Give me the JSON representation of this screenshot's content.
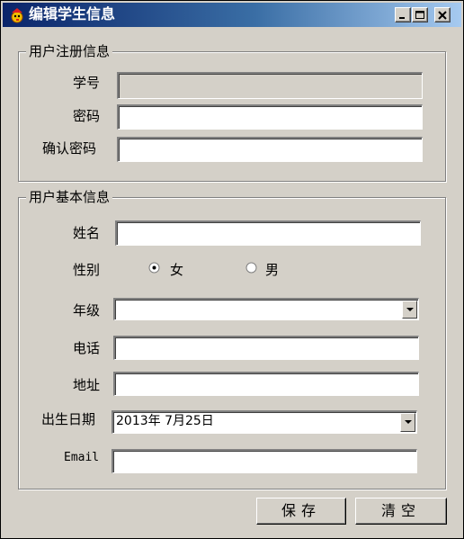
{
  "window": {
    "title": "编辑学生信息",
    "icon": "app-icon",
    "controls": {
      "minimize_icon": "minimize-icon",
      "maximize_icon": "maximize-icon",
      "close_icon": "close-icon"
    }
  },
  "registration": {
    "legend": "用户注册信息",
    "student_id": {
      "label": "学号",
      "value": ""
    },
    "password": {
      "label": "密码",
      "value": ""
    },
    "confirm_password": {
      "label": "确认密码",
      "value": ""
    }
  },
  "basic": {
    "legend": "用户基本信息",
    "name": {
      "label": "姓名",
      "value": ""
    },
    "gender": {
      "label": "性别",
      "options": [
        {
          "label": "女",
          "selected": true
        },
        {
          "label": "男",
          "selected": false
        }
      ]
    },
    "grade": {
      "label": "年级",
      "value": ""
    },
    "phone": {
      "label": "电话",
      "value": ""
    },
    "address": {
      "label": "地址",
      "value": ""
    },
    "birthdate": {
      "label": "出生日期",
      "value": "2013年 7月25日"
    },
    "email": {
      "label": "Email",
      "value": ""
    }
  },
  "buttons": {
    "save": "保存",
    "clear": "清空"
  },
  "colors": {
    "face": "#d4d0c8",
    "title_start": "#0a246a",
    "title_end": "#a6caf0"
  }
}
